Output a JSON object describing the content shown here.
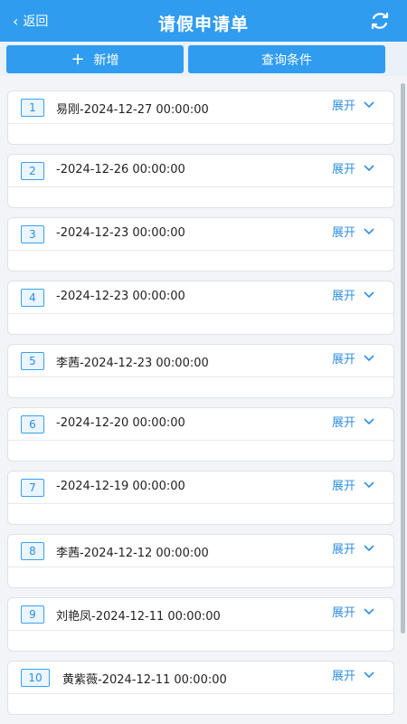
{
  "header": {
    "back_label": "返回",
    "title": "请假申请单"
  },
  "toolbar": {
    "add_label": "新增",
    "query_label": "查询条件"
  },
  "expand_label": "展开",
  "records": [
    {
      "index": "1",
      "text": "易刚-2024-12-27 00:00:00"
    },
    {
      "index": "2",
      "text": "-2024-12-26 00:00:00"
    },
    {
      "index": "3",
      "text": "-2024-12-23 00:00:00"
    },
    {
      "index": "4",
      "text": "-2024-12-23 00:00:00"
    },
    {
      "index": "5",
      "text": "李茜-2024-12-23 00:00:00"
    },
    {
      "index": "6",
      "text": "-2024-12-20 00:00:00"
    },
    {
      "index": "7",
      "text": "-2024-12-19 00:00:00"
    },
    {
      "index": "8",
      "text": "李茜-2024-12-12 00:00:00"
    },
    {
      "index": "9",
      "text": "刘艳凤-2024-12-11 00:00:00"
    },
    {
      "index": "10",
      "text": "黄紫薇-2024-12-11 00:00:00"
    }
  ]
}
